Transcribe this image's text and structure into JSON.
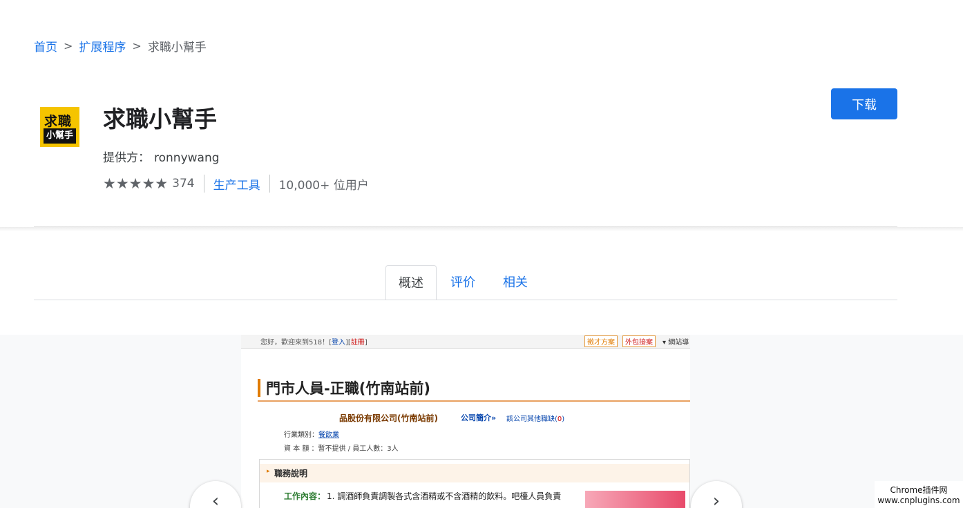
{
  "breadcrumb": {
    "home": "首页",
    "extensions": "扩展程序",
    "current": "求職小幫手",
    "separator": ">"
  },
  "extension": {
    "icon_line1": "求職",
    "icon_line2": "小幫手",
    "icon_color": "#f5c400",
    "title": "求職小幫手",
    "provider_label": "提供方：",
    "provider_name": "ronnywang",
    "stars_glyph": "★★★★★",
    "rating_value": 5,
    "rating_count": "374",
    "category": "生产工具",
    "users": "10,000+ 位用户"
  },
  "actions": {
    "download_label": "下载",
    "accent_color": "#1a73e8"
  },
  "tabs": [
    {
      "label": "概述",
      "active": true
    },
    {
      "label": "评价",
      "active": false
    },
    {
      "label": "相关",
      "active": false
    }
  ],
  "screenshot": {
    "welcome_prefix": "您好，歡迎來到518！[",
    "login": "登入",
    "mid": "][",
    "register": "註冊",
    "welcome_suffix": "]",
    "btn_talent": "徵才方案",
    "btn_outsource": "外包接案",
    "site_nav": "▾ 網站導",
    "job_title": "門市人員-正職(竹南站前)",
    "company": "品股份有限公司(竹南站前)",
    "company_intro": "公司簡介»",
    "other_jobs_prefix": "該公司其他職缺(",
    "other_jobs_count": "0",
    "other_jobs_suffix": ")",
    "industry_label": "行業類別：",
    "industry_value": "餐飲業",
    "capital": "資 本 額 ：暫不提供 / 員工人數：3人",
    "section_arrow": "▸",
    "section_title": "職務說明",
    "work_label": "工作內容：",
    "work_text": "1. 調酒師負責調製各式含酒精或不含酒精的飲料。吧檯人員負責"
  },
  "gallery_nav": {
    "prev_glyph": "‹",
    "next_glyph": "›"
  },
  "watermark": {
    "line1": "Chrome插件网",
    "line2": "www.cnplugins.com"
  }
}
